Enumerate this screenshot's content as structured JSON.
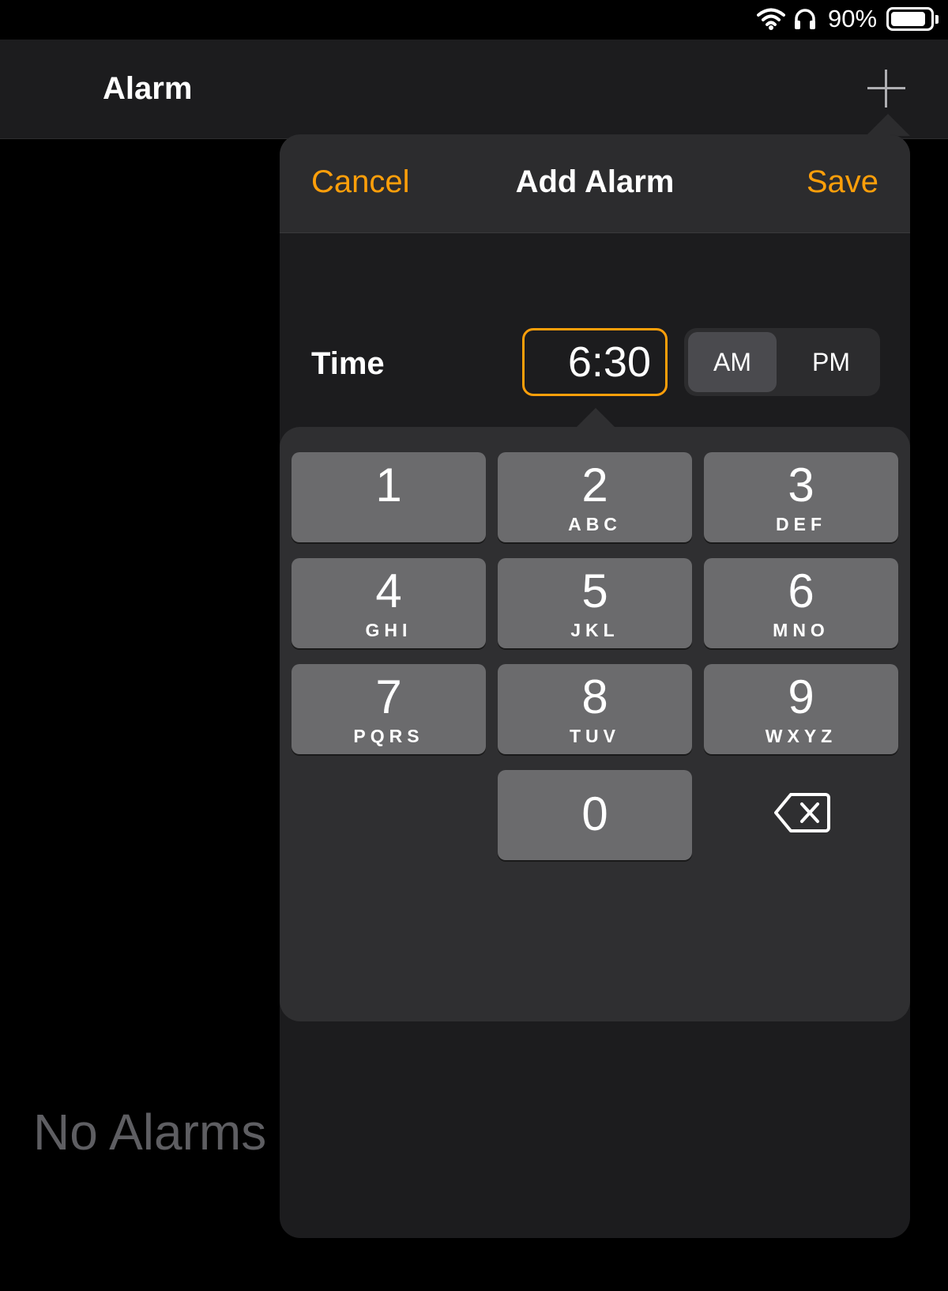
{
  "status": {
    "battery": "90%",
    "battery_level": 0.9
  },
  "header": {
    "title": "Alarm"
  },
  "empty_state": "No Alarms",
  "popover": {
    "cancel": "Cancel",
    "title": "Add Alarm",
    "save": "Save",
    "time_label": "Time",
    "time_value": "6:30",
    "am": "AM",
    "pm": "PM",
    "selected_period": "AM"
  },
  "keypad": {
    "keys": [
      {
        "digit": "1",
        "letters": ""
      },
      {
        "digit": "2",
        "letters": "ABC"
      },
      {
        "digit": "3",
        "letters": "DEF"
      },
      {
        "digit": "4",
        "letters": "GHI"
      },
      {
        "digit": "5",
        "letters": "JKL"
      },
      {
        "digit": "6",
        "letters": "MNO"
      },
      {
        "digit": "7",
        "letters": "PQRS"
      },
      {
        "digit": "8",
        "letters": "TUV"
      },
      {
        "digit": "9",
        "letters": "WXYZ"
      },
      {
        "digit": "0",
        "letters": ""
      }
    ]
  },
  "colors": {
    "accent": "#ff9f0a",
    "background": "#000000",
    "panel": "#1c1c1e"
  }
}
